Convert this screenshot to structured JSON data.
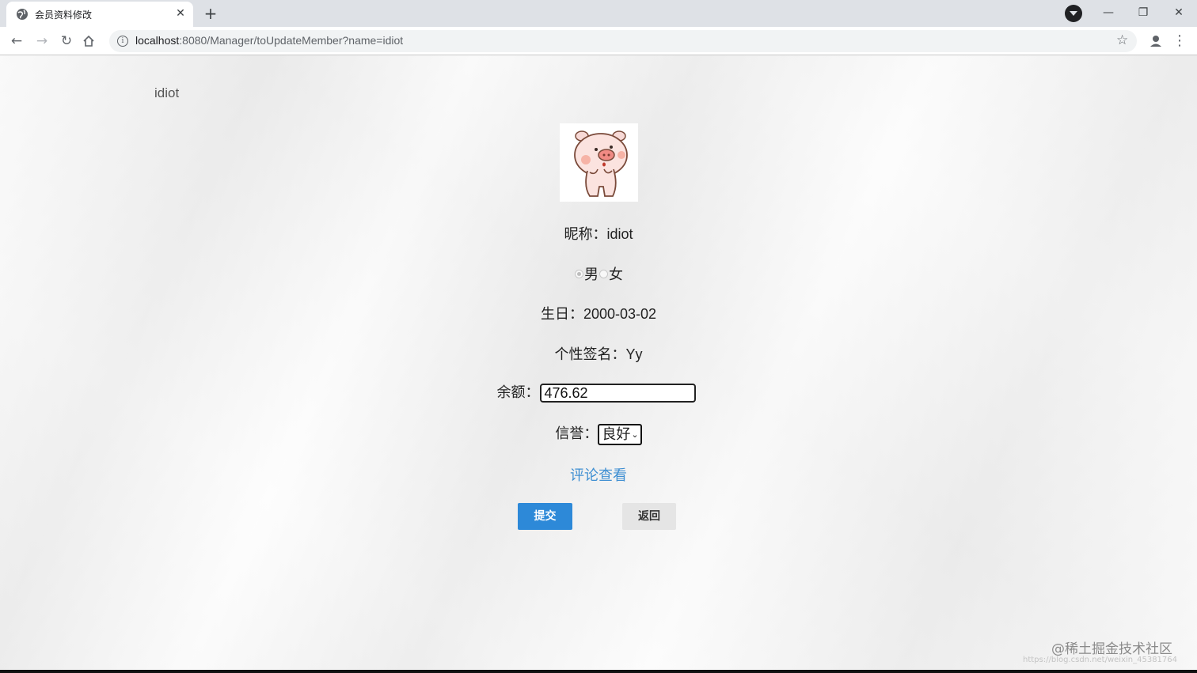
{
  "browser": {
    "tab_title": "会员资料修改",
    "url_host": "localhost",
    "url_rest": ":8080/Manager/toUpdateMember?name=idiot"
  },
  "page": {
    "username": "idiot",
    "nickname_label": "昵称：",
    "nickname": "idiot",
    "gender": {
      "options": [
        "男",
        "女"
      ],
      "selected": "男"
    },
    "birthday_label": "生日：",
    "birthday": "2000-03-02",
    "signature_label": "个性签名：",
    "signature": "Yy",
    "balance_label": "余额：",
    "balance": "476.62",
    "credit_label": "信誉：",
    "credit_selected": "良好",
    "review_link": "评论查看",
    "submit_label": "提交",
    "back_label": "返回"
  },
  "watermark": {
    "text": "@稀土掘金技术社区",
    "url": "https://blog.csdn.net/weixin_45381764"
  },
  "colors": {
    "accent": "#2d89d8",
    "link": "#3f8fd2"
  }
}
